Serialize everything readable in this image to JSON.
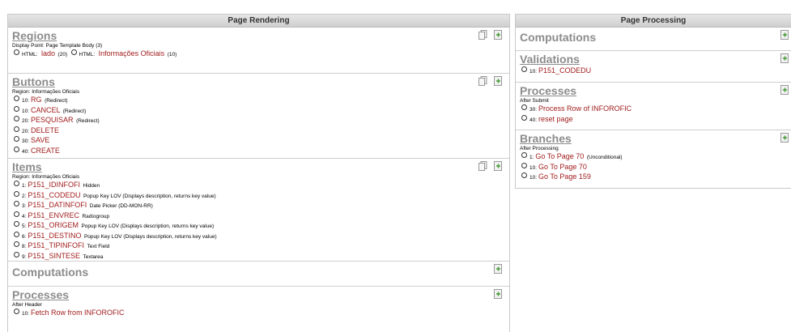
{
  "rendering": {
    "title": "Page Rendering",
    "regions": {
      "heading": "Regions",
      "display_point": "Display Point: Page Template Body (3)",
      "items": [
        {
          "tag": "HTML:",
          "label": "lado",
          "note": "(20)"
        },
        {
          "tag": "HTML:",
          "label": "Informações Oficiais",
          "note": "(10)"
        }
      ]
    },
    "buttons": {
      "heading": "Buttons",
      "region": "Region: Informações Oficiais",
      "items": [
        {
          "seq": "10:",
          "label": "RG",
          "note": "(Redirect)"
        },
        {
          "seq": "10:",
          "label": "CANCEL",
          "note": "(Redirect)"
        },
        {
          "seq": "20:",
          "label": "PESQUISAR",
          "note": "(Redirect)"
        },
        {
          "seq": "20:",
          "label": "DELETE",
          "note": ""
        },
        {
          "seq": "30:",
          "label": "SAVE",
          "note": ""
        },
        {
          "seq": "40:",
          "label": "CREATE",
          "note": ""
        }
      ]
    },
    "items": {
      "heading": "Items",
      "region": "Region: Informações Oficiais",
      "items": [
        {
          "seq": "1:",
          "label": "P151_IDINFOFI",
          "note": "Hidden"
        },
        {
          "seq": "2:",
          "label": "P151_CODEDU",
          "note": "Popup Key LOV (Displays description, returns key value)"
        },
        {
          "seq": "3:",
          "label": "P151_DATINFOFI",
          "note": "Date Picker (DD-MON-RR)"
        },
        {
          "seq": "4:",
          "label": "P151_ENVREC",
          "note": "Radiogroup"
        },
        {
          "seq": "5:",
          "label": "P151_ORIGEM",
          "note": "Popup Key LOV (Displays description, returns key value)"
        },
        {
          "seq": "6:",
          "label": "P151_DESTINO",
          "note": "Popup Key LOV (Displays description, returns key value)"
        },
        {
          "seq": "8:",
          "label": "P151_TIPINFOFI",
          "note": "Text Field"
        },
        {
          "seq": "9:",
          "label": "P151_SINTESE",
          "note": "Textarea"
        }
      ]
    },
    "computations": {
      "heading": "Computations"
    },
    "processes": {
      "heading": "Processes",
      "point": "After Header",
      "items": [
        {
          "seq": "10:",
          "label": "Fetch Row from INFOROFIC",
          "note": ""
        }
      ]
    }
  },
  "processing": {
    "title": "Page Processing",
    "computations": {
      "heading": "Computations"
    },
    "validations": {
      "heading": "Validations",
      "items": [
        {
          "seq": "10:",
          "label": "P151_CODEDU",
          "note": ""
        }
      ]
    },
    "processes": {
      "heading": "Processes",
      "point": "After Submit",
      "items": [
        {
          "seq": "30:",
          "label": "Process Row of INFOROFIC",
          "note": ""
        },
        {
          "seq": "40:",
          "label": "reset page",
          "note": ""
        }
      ]
    },
    "branches": {
      "heading": "Branches",
      "point": "After Processing",
      "items": [
        {
          "seq": "1:",
          "label": "Go To Page  70",
          "note": "(Unconditional)"
        },
        {
          "seq": "10:",
          "label": "Go To Page  70",
          "note": ""
        },
        {
          "seq": "10:",
          "label": "Go To Page  159",
          "note": ""
        }
      ]
    }
  },
  "icons": {
    "copy": "copy-icon",
    "create": "create-icon"
  }
}
